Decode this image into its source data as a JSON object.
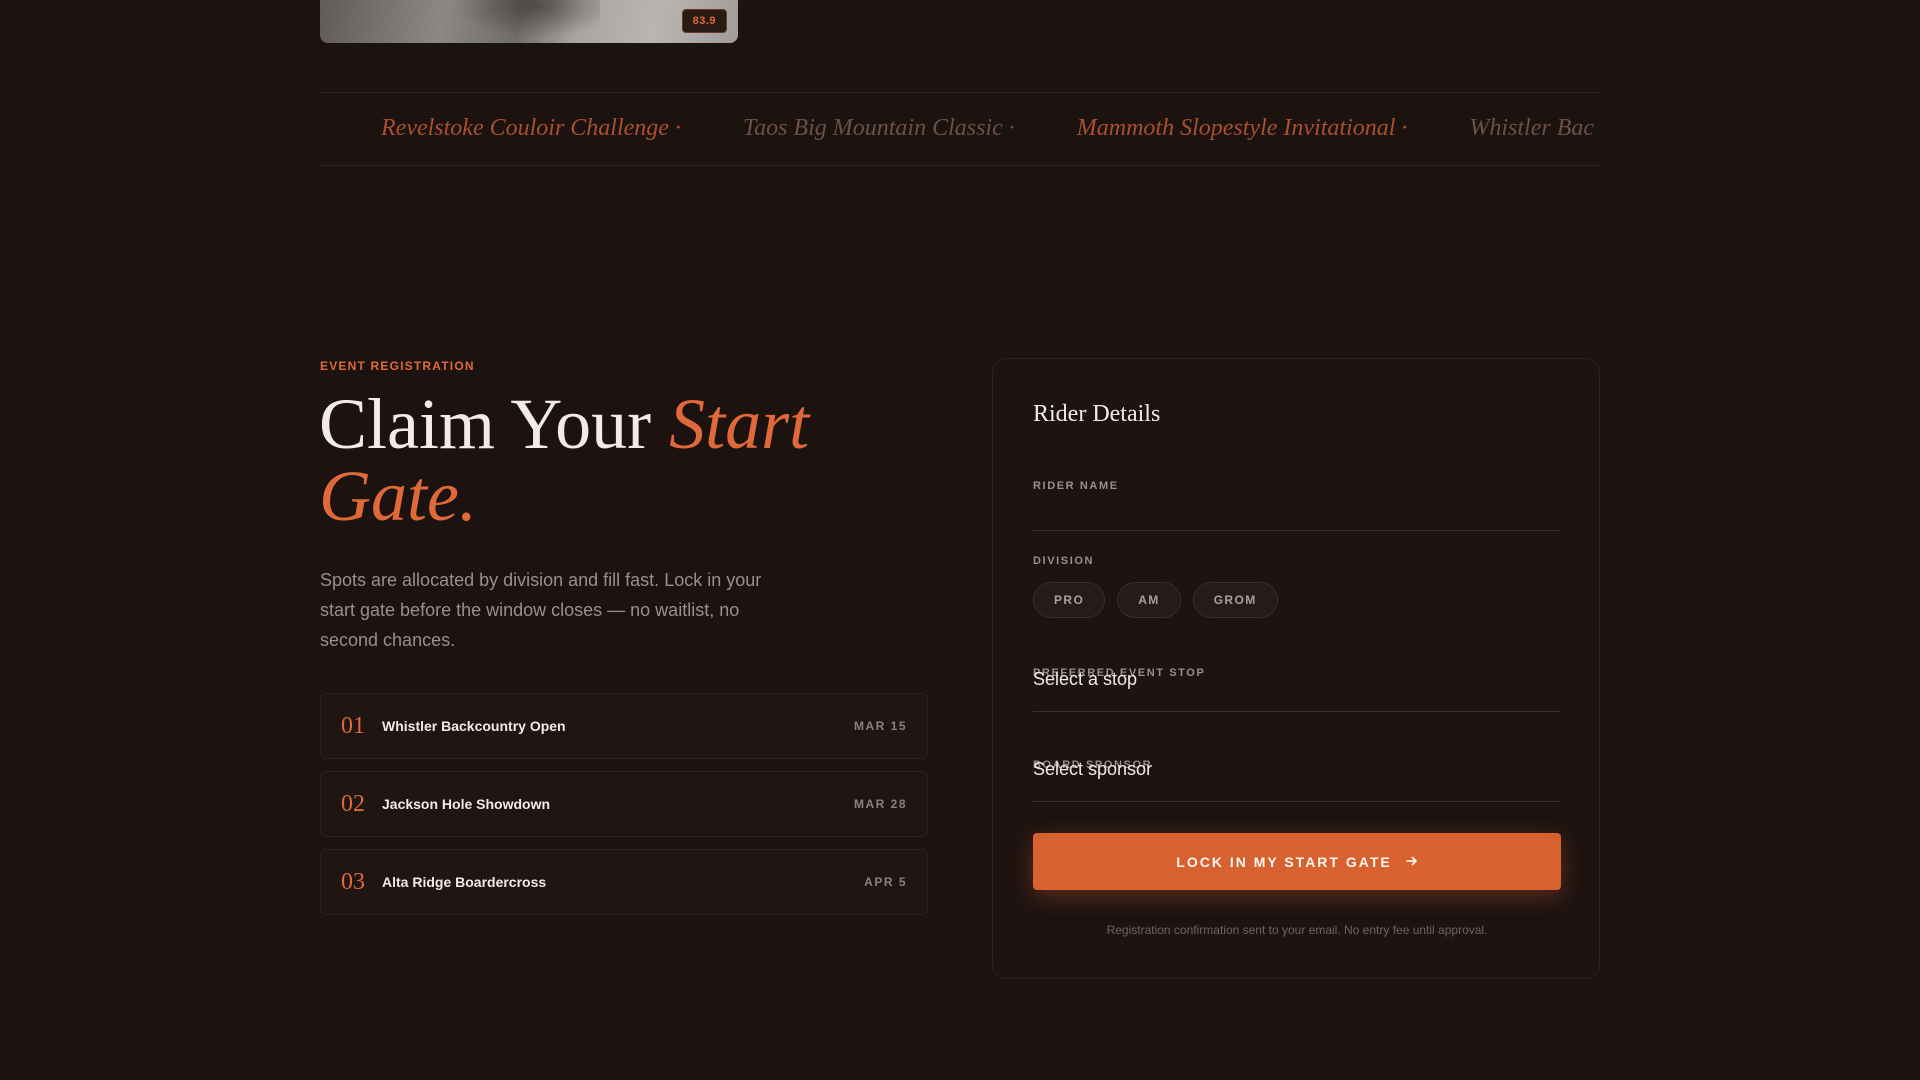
{
  "hero": {
    "badge": "83.9"
  },
  "ticker": {
    "items": [
      "Revelstoke Couloir Challenge ·",
      "Taos Big Mountain Classic ·",
      "Mammoth Slopestyle Invitational ·",
      "Whistler Bac"
    ]
  },
  "registration": {
    "eyebrow": "EVENT REGISTRATION",
    "headline_plain": "Claim Your ",
    "headline_accent": "Start Gate.",
    "lead": "Spots are allocated by division and fill fast. Lock in your start gate before the window closes — no waitlist, no second chances.",
    "events": [
      {
        "num": "01",
        "name": "Whistler Backcountry Open",
        "date": "MAR 15"
      },
      {
        "num": "02",
        "name": "Jackson Hole Showdown",
        "date": "MAR 28"
      },
      {
        "num": "03",
        "name": "Alta Ridge Boardercross",
        "date": "APR 5"
      }
    ]
  },
  "form": {
    "title": "Rider Details",
    "rider_name_label": "RIDER NAME",
    "rider_name_value": "",
    "division_label": "DIVISION",
    "divisions": [
      "PRO",
      "AM",
      "GROM"
    ],
    "event_stop_label": "PREFERRED EVENT STOP",
    "event_stop_value": "Select a stop",
    "sponsor_label": "BOARD SPONSOR",
    "sponsor_value": "Select sponsor",
    "submit_label": "LOCK IN MY START GATE",
    "fineprint": "Registration confirmation sent to your email. No entry fee until approval."
  },
  "colors": {
    "background": "#1c1210",
    "accent": "#e0693a",
    "button": "#d8622f"
  }
}
